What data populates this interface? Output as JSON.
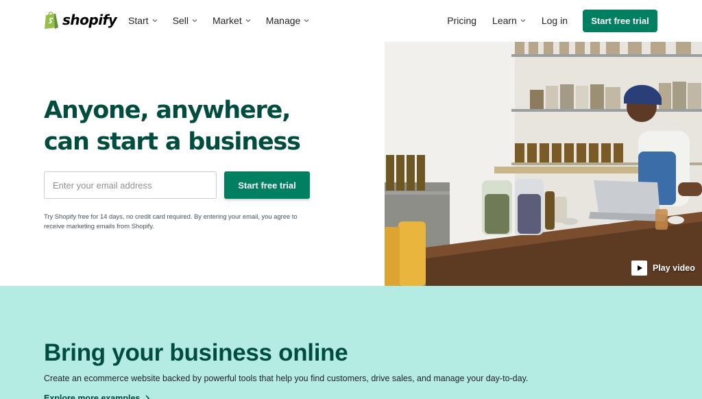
{
  "brand": {
    "name": "shopify",
    "color": "#95bf47",
    "primary": "#008060",
    "dark_green": "#004c3f"
  },
  "nav": {
    "left": [
      {
        "label": "Start"
      },
      {
        "label": "Sell"
      },
      {
        "label": "Market"
      },
      {
        "label": "Manage"
      }
    ],
    "pricing": "Pricing",
    "learn": "Learn",
    "login": "Log in",
    "cta": "Start free trial"
  },
  "hero": {
    "title_line1": "Anyone, anywhere,",
    "title_line2": "can start a business",
    "email_placeholder": "Enter your email address",
    "cta": "Start free trial",
    "disclaimer": "Try Shopify free for 14 days, no credit card required. By entering your email, you agree to receive marketing emails from Shopify.",
    "play_video": "Play video"
  },
  "section": {
    "title": "Bring your business online",
    "subtitle": "Create an ecommerce website backed by powerful tools that help you find customers, drive sales, and manage your day-to-day.",
    "link": "Explore more examples",
    "background": "#b4ece3"
  }
}
